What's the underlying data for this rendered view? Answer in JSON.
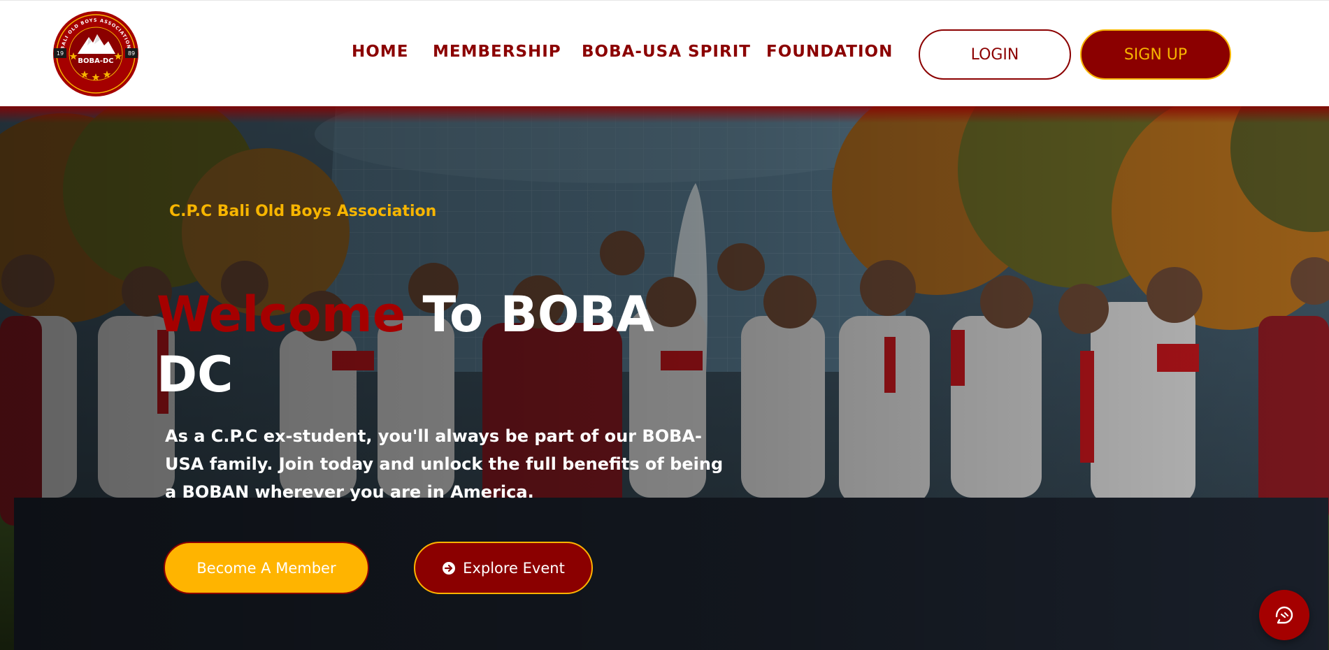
{
  "header": {
    "logo": {
      "icon": "boba-dc-crest",
      "text": "BOBA-DC",
      "year_left": "19",
      "year_right": "89",
      "ring_text": "BALI OLD BOYS ASSOCIATION"
    },
    "nav": [
      {
        "label": "HOME"
      },
      {
        "label": "MEMBERSHIP"
      },
      {
        "label": "BOBA-USA SPIRIT"
      },
      {
        "label": "FOUNDATION"
      }
    ],
    "login_label": "LOGIN",
    "signup_label": "SIGN UP"
  },
  "hero": {
    "subtitle": "C.P.C Bali Old Boys Association",
    "title_highlight": "Welcome",
    "title_rest": " To BOBA DC",
    "description": "As a C.P.C ex-student, you'll always be part of our BOBA-USA family. Join today and unlock the full benefits of being a BOBAN wherever you are in America.",
    "member_button": "Become A Member",
    "event_button": "Explore Event",
    "event_icon": "arrow-circle-right-icon",
    "background": "group-photo-of-members-in-front-of-glass-building"
  },
  "chat": {
    "icon": "chat-support-icon"
  },
  "colors": {
    "brand_red": "#8b0000",
    "title_red": "#a50000",
    "accent_gold": "#ffb400",
    "signup_text": "#f7b500"
  }
}
